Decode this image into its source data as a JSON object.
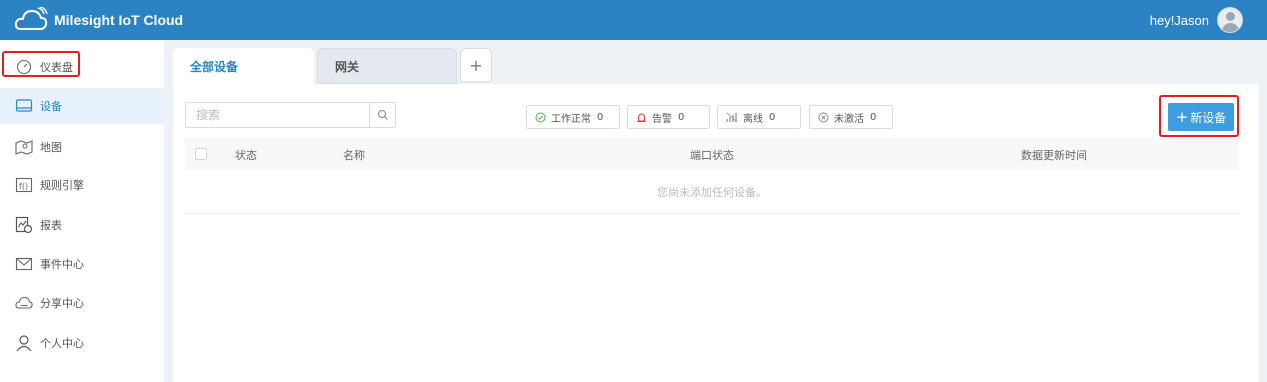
{
  "header": {
    "brand": "Milesight IoT Cloud",
    "user_greeting": "hey!Jason"
  },
  "sidebar": {
    "items": [
      {
        "label": "仪表盘",
        "icon": "dashboard-icon"
      },
      {
        "label": "设备",
        "icon": "device-icon",
        "active": true
      },
      {
        "label": "地图",
        "icon": "map-icon"
      },
      {
        "label": "规则引擎",
        "icon": "rule-engine-icon"
      },
      {
        "label": "报表",
        "icon": "report-icon"
      },
      {
        "label": "事件中心",
        "icon": "mail-icon"
      },
      {
        "label": "分享中心",
        "icon": "share-cloud-icon"
      },
      {
        "label": "个人中心",
        "icon": "user-icon"
      }
    ]
  },
  "tabs": {
    "all_devices": "全部设备",
    "gateway": "网关",
    "add": "+"
  },
  "toolbar": {
    "search_placeholder": "搜索",
    "filters": [
      {
        "label": "工作正常",
        "count": "0",
        "icon": "check-circle-icon"
      },
      {
        "label": "告警",
        "count": "0",
        "icon": "alarm-icon"
      },
      {
        "label": "离线",
        "count": "0",
        "icon": "offline-signal-icon"
      },
      {
        "label": "未激活",
        "count": "0",
        "icon": "x-circle-icon"
      }
    ],
    "new_device_label": "新设备"
  },
  "table": {
    "columns": [
      "状态",
      "名称",
      "端口状态",
      "数据更新时间"
    ],
    "empty_text": "您尚未添加任何设备。"
  },
  "colors": {
    "header_bg": "#2c83c4",
    "accent": "#3d9de0",
    "highlight": "#e02020"
  }
}
